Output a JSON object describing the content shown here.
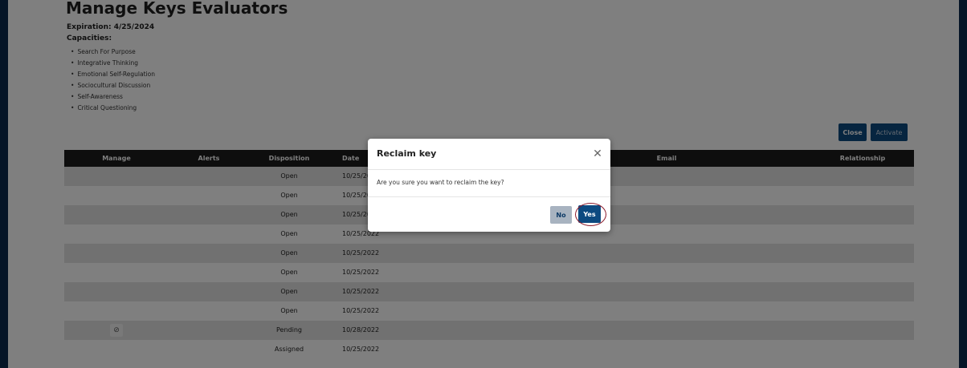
{
  "page": {
    "title": "Manage Keys Evaluators",
    "expiration": "Expiration: 4/25/2024",
    "capacities_label": "Capacities:",
    "capacities": [
      "Search For Purpose",
      "Integrative Thinking",
      "Emotional Self-Regulation",
      "Sociocultural Discussion",
      "Self-Awareness",
      "Critical Questioning"
    ]
  },
  "toolbar": {
    "close_label": "Close",
    "activate_label": "Activate"
  },
  "table": {
    "headers": {
      "manage": "Manage",
      "alerts": "Alerts",
      "disposition": "Disposition",
      "date": "Date",
      "email": "Email",
      "relationship": "Relationship"
    },
    "rows": [
      {
        "manage": "",
        "alerts": "",
        "disposition": "Open",
        "date": "10/25/2022",
        "email": "",
        "relationship": ""
      },
      {
        "manage": "",
        "alerts": "",
        "disposition": "Open",
        "date": "10/25/2022",
        "email": "",
        "relationship": ""
      },
      {
        "manage": "",
        "alerts": "",
        "disposition": "Open",
        "date": "10/25/2022",
        "email": "",
        "relationship": ""
      },
      {
        "manage": "",
        "alerts": "",
        "disposition": "Open",
        "date": "10/25/2022",
        "email": "",
        "relationship": ""
      },
      {
        "manage": "",
        "alerts": "",
        "disposition": "Open",
        "date": "10/25/2022",
        "email": "",
        "relationship": ""
      },
      {
        "manage": "",
        "alerts": "",
        "disposition": "Open",
        "date": "10/25/2022",
        "email": "",
        "relationship": ""
      },
      {
        "manage": "",
        "alerts": "",
        "disposition": "Open",
        "date": "10/25/2022",
        "email": "",
        "relationship": ""
      },
      {
        "manage": "",
        "alerts": "",
        "disposition": "Open",
        "date": "10/25/2022",
        "email": "",
        "relationship": ""
      },
      {
        "manage": "cancel-icon",
        "alerts": "",
        "disposition": "Pending",
        "date": "10/28/2022",
        "email": "",
        "relationship": ""
      },
      {
        "manage": "",
        "alerts": "",
        "disposition": "Assigned",
        "date": "10/25/2022",
        "email": "",
        "relationship": ""
      }
    ]
  },
  "modal": {
    "title": "Reclaim key",
    "close_icon": "close-icon",
    "message": "Are you sure you want to reclaim the key?",
    "no_label": "No",
    "yes_label": "Yes"
  },
  "colors": {
    "brand_navy": "#0b2a4f",
    "button_primary": "#0d4a80",
    "button_secondary": "#a8b3c0",
    "header_bg": "#1c1c1c",
    "highlight_ring": "#8b1a2b"
  }
}
